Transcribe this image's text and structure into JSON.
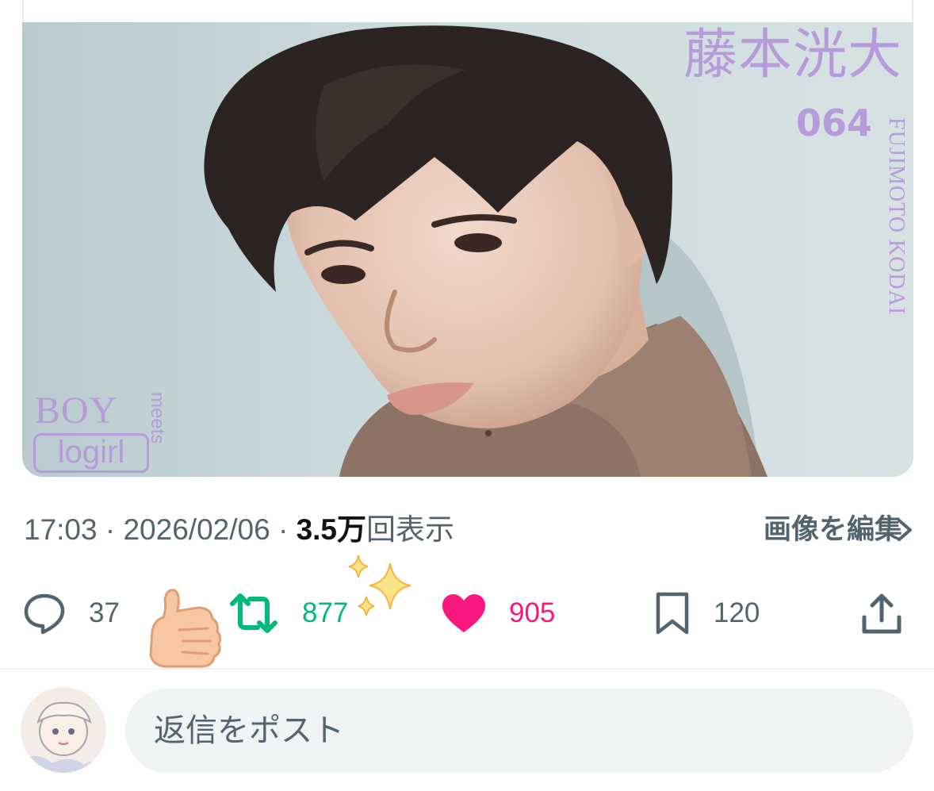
{
  "photo": {
    "name_jp": "藤本洸大",
    "serial": "064",
    "name_en": "FUJIMOTO KODAI",
    "logo_boy": "BOY",
    "logo_meets": "meets",
    "logo_logirl": "logirl"
  },
  "meta": {
    "time": "17:03",
    "sep1": " · ",
    "date": "2026/02/06",
    "sep2": " · ",
    "views_number": "3.5万",
    "views_label": "回表示",
    "edit_image_label": "画像を編集"
  },
  "actions": {
    "reply_count": "37",
    "repost_count": "877",
    "like_count": "905",
    "bookmark_count": "120"
  },
  "composer": {
    "placeholder": "返信をポスト"
  },
  "colors": {
    "text_secondary": "#536471",
    "repost_green": "#00ba7c",
    "like_pink": "#f91880",
    "overlay_lavender": "#b79ad9"
  },
  "icons": [
    "reply-icon",
    "repost-icon",
    "like-heart-icon",
    "bookmark-icon",
    "share-icon",
    "chevron-right-icon",
    "thumbs-up-sticker",
    "sparkles-sticker"
  ]
}
